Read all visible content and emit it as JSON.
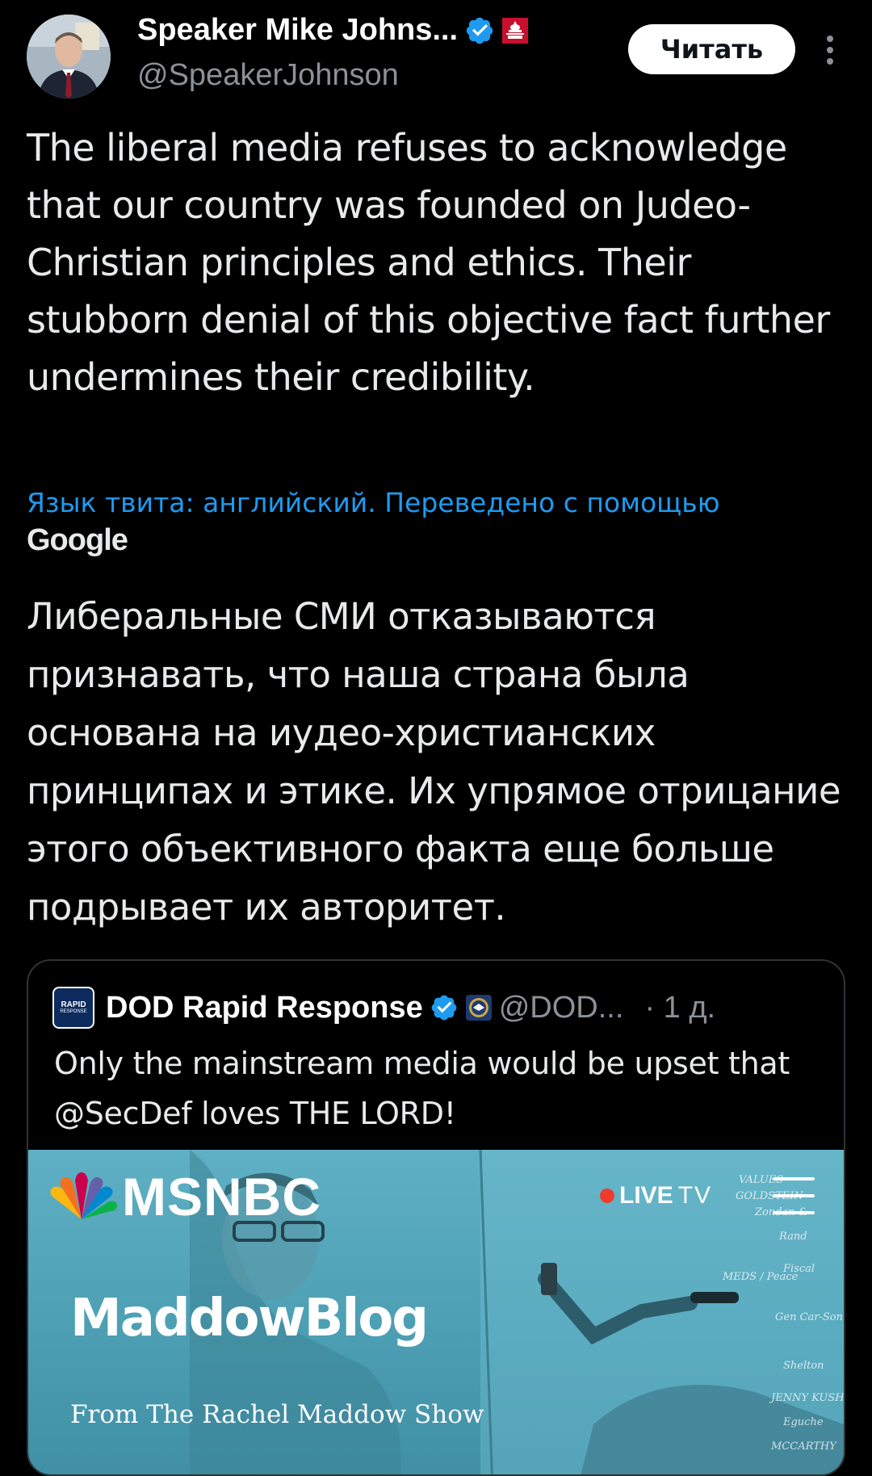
{
  "author": {
    "display_name": "Speaker Mike Johns...",
    "handle": "@SpeakerJohnson",
    "avatar": "avatar-portrait"
  },
  "header": {
    "follow_label": "Читать",
    "more_icon": "more-vertical-icon"
  },
  "tweet": {
    "text": "The liberal media refuses to acknowledge that our country was founded on Judeo-Christian principles and ethics. Their stubborn denial of this objective fact further undermines their credibility.",
    "translation_note": "Язык твита: английский. Переведено с помощью",
    "translation_provider": "Google",
    "translated_text": "Либеральные СМИ отказываются признавать, что наша страна была основана на иудео-христианских принципах и этике. Их упрямое отрицание этого объективного факта еще больше подрывает их авторитет."
  },
  "quote": {
    "avatar_label_top": "RAPID",
    "avatar_label_bottom": "RESPONSE",
    "display_name": "DOD Rapid Response",
    "handle": "@DOD...",
    "time": "· 1 д.",
    "text": "Only the mainstream media would be upset that @SecDef loves THE LORD!",
    "media": {
      "brand": "MSNBC",
      "live_label": "LIVE",
      "tv_label": "TV",
      "blog_title": "MaddowBlog",
      "blog_subtitle": "From The Rachel Maddow Show"
    }
  },
  "colors": {
    "background": "#000000",
    "text": "#e7e9ea",
    "secondary": "#8b9197",
    "link": "#1d9bf0",
    "verified": "#1d9bf0",
    "border": "#2f3336",
    "media_teal": "#4c9eb3"
  }
}
